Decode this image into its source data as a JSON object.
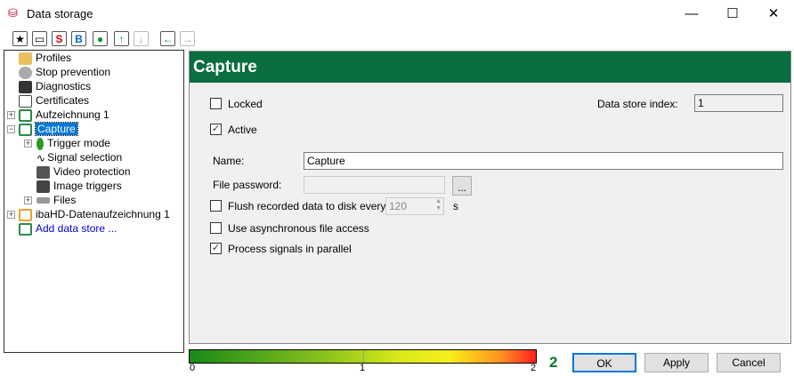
{
  "window": {
    "title": "Data storage",
    "minimize": "—",
    "maximize": "☐",
    "close": "✕"
  },
  "toolbar": [
    "new",
    "open",
    "S",
    "B",
    "save",
    "up",
    "down",
    "back",
    "forward"
  ],
  "tree": [
    {
      "label": "Profiles",
      "color": "#e8c060"
    },
    {
      "label": "Stop prevention",
      "color": "#aaa"
    },
    {
      "label": "Diagnostics",
      "color": "#333"
    },
    {
      "label": "Certificates",
      "color": "#666"
    },
    {
      "label": "Aufzeichnung 1",
      "color": "#2a8a4a"
    },
    {
      "label": "Capture",
      "color": "#2a8a4a"
    },
    {
      "label": "Trigger mode",
      "color": "#2a9a2a"
    },
    {
      "label": "Signal selection",
      "color": "#fff"
    },
    {
      "label": "Video protection",
      "color": "#555"
    },
    {
      "label": "Image triggers",
      "color": "#444"
    },
    {
      "label": "Files",
      "color": "#999"
    },
    {
      "label": "ibaHD-Datenaufzeichnung 1",
      "color": "#e8a030"
    },
    {
      "label": "Add data store ...",
      "color": "#e8c060"
    }
  ],
  "panel": {
    "title": "Capture",
    "locked": "Locked",
    "locked_checked": false,
    "active": "Active",
    "active_checked": true,
    "index_label": "Data store index:",
    "index_value": "1",
    "name_label": "Name:",
    "name_value": "Capture",
    "password_label": "File password:",
    "browse": "...",
    "flush_label": "Flush recorded data to disk every",
    "flush_value": "120",
    "flush_unit": "s",
    "async_label": "Use asynchronous file access",
    "parallel_label": "Process signals in parallel"
  },
  "footer": {
    "scale": [
      "0",
      "1",
      "2"
    ],
    "level": "2",
    "ok": "OK",
    "apply": "Apply",
    "cancel": "Cancel"
  }
}
